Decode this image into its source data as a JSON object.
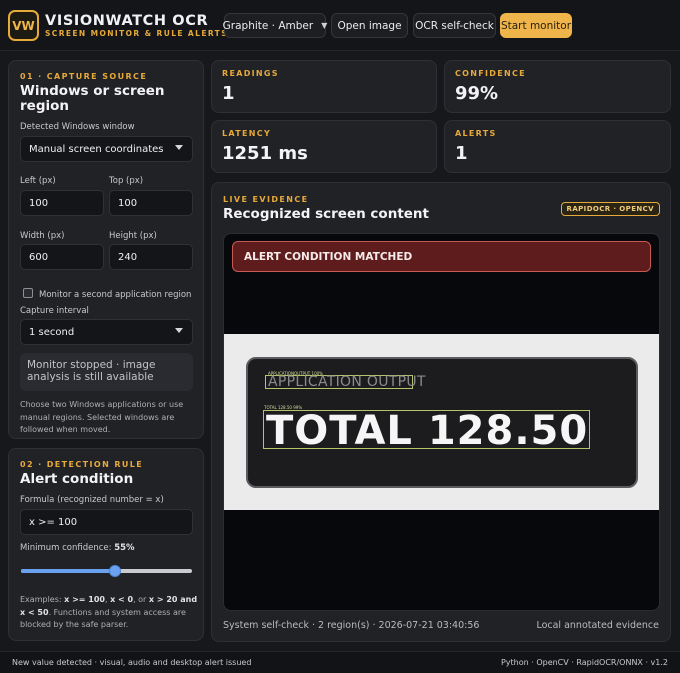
{
  "app": {
    "logo": "VW",
    "title": "VISIONWATCH OCR",
    "subtitle": "SCREEN MONITOR & RULE ALERTS"
  },
  "toolbar": {
    "theme_select": "Graphite · Amber",
    "open_image": "Open image",
    "self_check": "OCR self-check",
    "start_monitor": "Start monitor"
  },
  "capture": {
    "tag": "01 · CAPTURE SOURCE",
    "title": "Windows or screen region",
    "window_label": "Detected Windows window",
    "window_value": "Manual screen coordinates",
    "left_label": "Left (px)",
    "left_value": "100",
    "top_label": "Top (px)",
    "top_value": "100",
    "width_label": "Width (px)",
    "width_value": "600",
    "height_label": "Height (px)",
    "height_value": "240",
    "second_region_label": "Monitor a second application region",
    "second_region_checked": false,
    "interval_label": "Capture interval",
    "interval_value": "1 second",
    "status": "Monitor stopped · image analysis is still available",
    "note": "Choose two Windows applications or use manual regions. Selected windows are followed when moved."
  },
  "rule": {
    "tag": "02 · DETECTION RULE",
    "title": "Alert condition",
    "formula_label": "Formula (recognized number = x)",
    "formula_value": "x >= 100",
    "confidence_label": "Minimum confidence:",
    "confidence_value": "55%",
    "confidence_fraction": 0.55,
    "examples_prefix": "Examples:",
    "example_1": "x >= 100",
    "example_2": "x < 0",
    "example_or": ", or",
    "example_3": "x > 20 and x < 50",
    "examples_suffix": ". Functions and system access are blocked by the safe parser."
  },
  "stats": {
    "readings_label": "READINGS",
    "readings_value": "1",
    "confidence_label": "CONFIDENCE",
    "confidence_value": "99%",
    "latency_label": "LATENCY",
    "latency_value": "1251 ms",
    "alerts_label": "ALERTS",
    "alerts_value": "1"
  },
  "evidence": {
    "tag": "LIVE EVIDENCE",
    "title": "Recognized screen content",
    "engine_badge": "RAPIDOCR · OPENCV",
    "alert_banner": "ALERT CONDITION MATCHED",
    "screen_app_text": "APPLICATION OUTPUT",
    "screen_app_tiny": "APPLICATIONOUTPUT 100%",
    "screen_total_text": "TOTAL 128.50",
    "screen_total_tiny": "TOTAL 128.50 99%",
    "footer_left": "System self-check · 2 region(s) · 2026-07-21 03:40:56",
    "footer_right": "Local annotated evidence"
  },
  "statusbar": {
    "left": "New value detected · visual, audio and desktop alert issued",
    "right": "Python · OpenCV · RapidOCR/ONNX · v1.2"
  },
  "colors": {
    "accent": "#f0b54a",
    "alert": "#5e1c1c",
    "ocr_box": "#b6c46a",
    "slider": "#6aa2f0"
  }
}
